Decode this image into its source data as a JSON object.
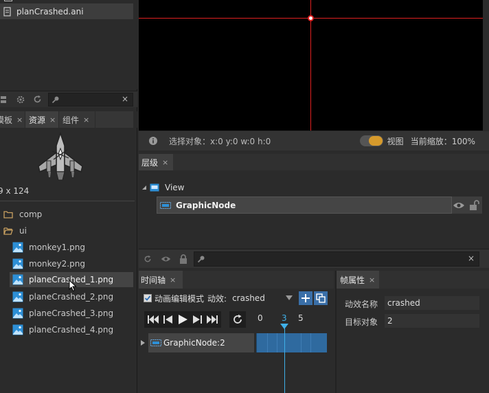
{
  "file_list": {
    "active_file": "planCrashed.ani"
  },
  "resource_panel": {
    "toolbar": {
      "clear_label": "×"
    },
    "tabs": [
      {
        "label": "模板",
        "close": "×"
      },
      {
        "label": "资源",
        "close": "×"
      },
      {
        "label": "组件",
        "close": "×"
      }
    ],
    "preview_size": "9 x 124",
    "tree": [
      {
        "label": "comp",
        "type": "folder"
      },
      {
        "label": "ui",
        "type": "folder-open"
      },
      {
        "label": "monkey1.png",
        "type": "image"
      },
      {
        "label": "monkey2.png",
        "type": "image"
      },
      {
        "label": "planeCrashed_1.png",
        "type": "image",
        "selected": true
      },
      {
        "label": "planeCrashed_2.png",
        "type": "image"
      },
      {
        "label": "planeCrashed_3.png",
        "type": "image"
      },
      {
        "label": "planeCrashed_4.png",
        "type": "image"
      }
    ]
  },
  "stage": {
    "status": {
      "selection": "选择对象：x:0 y:0  w:0 h:0",
      "view_label": "视图",
      "zoom": "当前缩放：100%"
    }
  },
  "hierarchy": {
    "tab": "层级",
    "close": "×",
    "root": "View",
    "child": "GraphicNode"
  },
  "lower_toolbar": {
    "clear_label": "×"
  },
  "timeline": {
    "tab": "时间轴",
    "close": "×",
    "edit_mode_label": "动画编辑模式",
    "effect_label": "动效:",
    "effect_value": "crashed",
    "ruler": [
      "0",
      "3",
      "5"
    ],
    "current_frame": 3,
    "node_label": "GraphicNode:2"
  },
  "frame_props": {
    "tab": "帧属性",
    "close": "×",
    "name_label": "动效名称",
    "name_value": "crashed",
    "target_label": "目标对象",
    "target_value": "2"
  },
  "colors": {
    "accent": "#3399cc",
    "toggle": "#d69a2c",
    "crosshair": "#e02020"
  }
}
